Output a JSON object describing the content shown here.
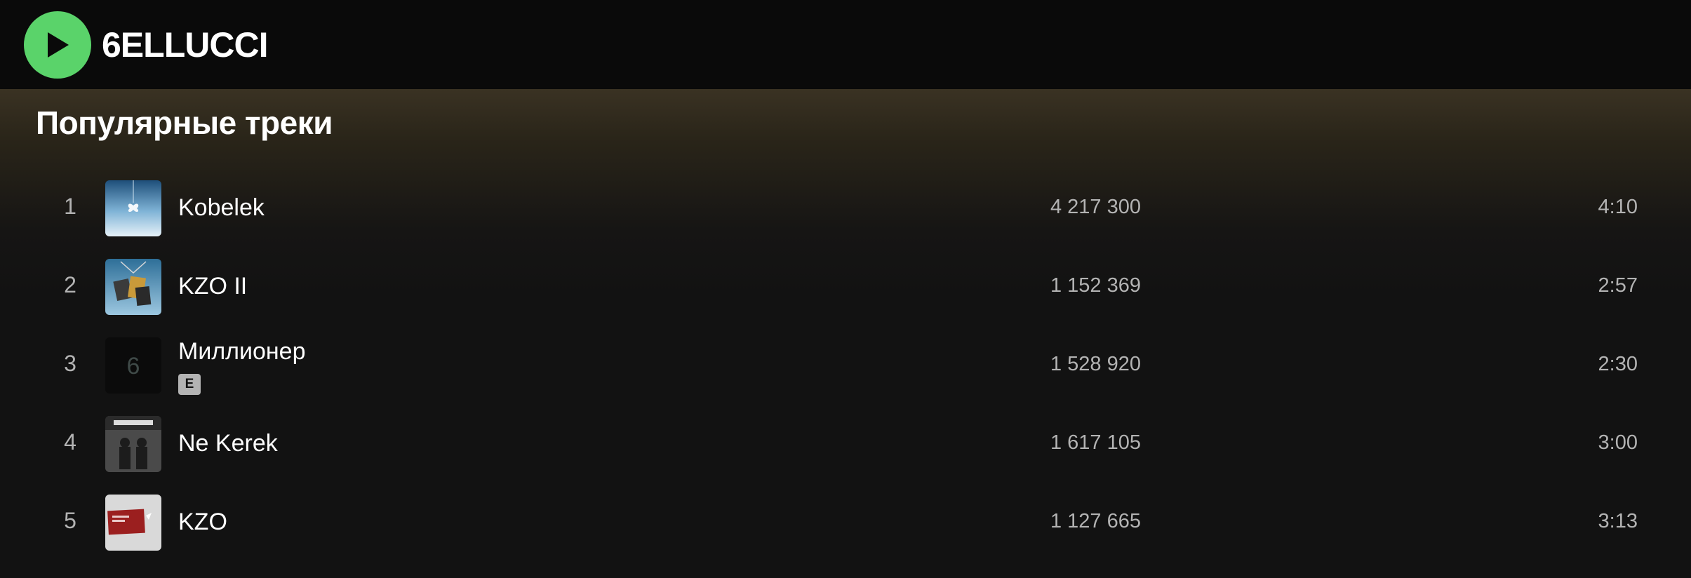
{
  "header": {
    "play_icon": "play-icon",
    "artist_name": "6ELLUCCI",
    "accent_color": "#5ad36a"
  },
  "section": {
    "title": "Популярные треки"
  },
  "tracks": [
    {
      "number": "1",
      "title": "Kobelek",
      "plays": "4 217 300",
      "duration": "4:10",
      "explicit": false
    },
    {
      "number": "2",
      "title": "KZO II",
      "plays": "1 152 369",
      "duration": "2:57",
      "explicit": false
    },
    {
      "number": "3",
      "title": "Миллионер",
      "plays": "1 528 920",
      "duration": "2:30",
      "explicit": true,
      "explicit_label": "E"
    },
    {
      "number": "4",
      "title": "Ne Kerek",
      "plays": "1 617 105",
      "duration": "3:00",
      "explicit": false
    },
    {
      "number": "5",
      "title": "KZO",
      "plays": "1 127 665",
      "duration": "3:13",
      "explicit": false
    }
  ]
}
